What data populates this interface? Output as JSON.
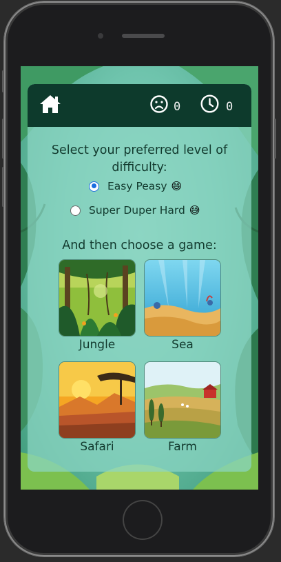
{
  "header": {
    "mistakes_count": "0",
    "timer_count": "0"
  },
  "difficulty": {
    "prompt_line1": "Select your preferred level of",
    "prompt_line2": "difficulty:",
    "options": [
      {
        "label": "Easy Peasy",
        "emoji": "😄",
        "selected": true
      },
      {
        "label": "Super Duper Hard",
        "emoji": "😅",
        "selected": false
      }
    ]
  },
  "games": {
    "prompt": "And then choose a game:",
    "items": [
      {
        "label": "Jungle"
      },
      {
        "label": "Sea"
      },
      {
        "label": "Safari"
      },
      {
        "label": "Farm"
      }
    ]
  },
  "colors": {
    "topbar": "#0d3a2c",
    "text": "#123a2e",
    "radio_selected": "#1a6de0"
  }
}
